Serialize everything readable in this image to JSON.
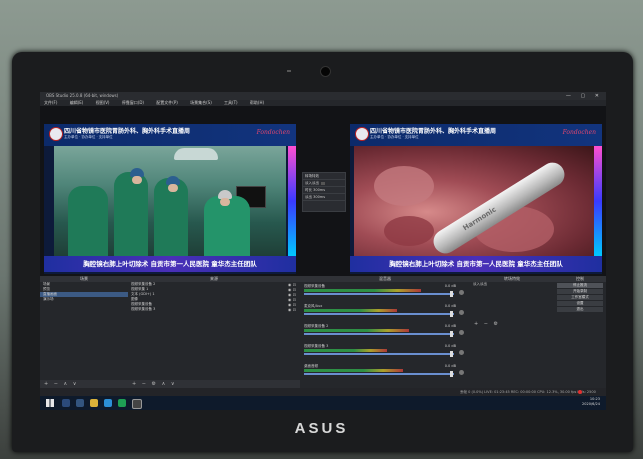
{
  "app": {
    "title": "OBS Studio 25.0.8 (64-bit, windows)",
    "window_controls": "— ▢ ✕",
    "menu": [
      "文件(F)",
      "编辑(E)",
      "视图(V)",
      "停靠窗口(D)",
      "配置文件(P)",
      "场景集合(S)",
      "工具(T)",
      "帮助(H)"
    ]
  },
  "preview": {
    "title": "四川省物镜市医院胃肠外科、胸外科手术直播周",
    "subtitle": "主办单位  ·  协办单位  ·  支持单位",
    "brand": "Fondochen",
    "banner": "胸腔镜右肺上叶切除术  自贡市第一人民医院  童华杰主任团队"
  },
  "program": {
    "title": "四川省物镜市医院胃肠外科、胸外科手术直播周",
    "subtitle": "主办单位  ·  协办单位  ·  支持单位",
    "brand": "Fondochen",
    "banner": "胸腔镜右肺上叶切除术  自贡市第一人民医院  童华杰主任团队",
    "instrument_text": "Harmonic"
  },
  "transition_panel": {
    "title": "转场特效",
    "rows": [
      "淡入淡出",
      "时长  300ms",
      "淡出  300ms"
    ]
  },
  "docks": {
    "scenes": {
      "header": "场景",
      "items": [
        "场景",
        "预览",
        "直播画面",
        "演示场"
      ],
      "selected": 2,
      "footer": "+ − ∧ ∨"
    },
    "sources": {
      "header": "来源",
      "items": [
        "视频采集设备 2",
        "视频采集 1",
        "文本 (GDI+) 1",
        "图像",
        "视频采集设备",
        "视频采集设备 3"
      ],
      "footer": "+ − ⚙ ∧ ∨"
    },
    "mixer": {
      "header": "混音器",
      "channels": [
        {
          "label": "视频采集设备",
          "db": "0.0 dB",
          "level": 0.78
        },
        {
          "label": "麦克风/Aux",
          "db": "0.0 dB",
          "level": 0.62
        },
        {
          "label": "视频采集设备 2",
          "db": "0.0 dB",
          "level": 0.7
        },
        {
          "label": "视频采集设备 3",
          "db": "0.0 dB",
          "level": 0.55
        },
        {
          "label": "桌面音频",
          "db": "0.0 dB",
          "level": 0.66
        }
      ]
    },
    "transitions": {
      "header": "转场特效",
      "value": "淡入淡出",
      "footer": "+ − ⚙"
    },
    "controls": {
      "header": "控制",
      "buttons": [
        "停止推流",
        "开始录制",
        "工作室模式",
        "设置",
        "退出"
      ]
    }
  },
  "status": {
    "text": "丢帧 0 (0.0%)   LIVE: 01:23:45   REC: 00:00:00   CPU: 12.3%, 30.00 fps   kb/s: 2500"
  },
  "taskbar": {
    "time": "10:23",
    "date": "2020/6/24"
  },
  "device_brand": "ASUS",
  "colors": {
    "accent": "#3c5a84",
    "live": "#e23030"
  }
}
